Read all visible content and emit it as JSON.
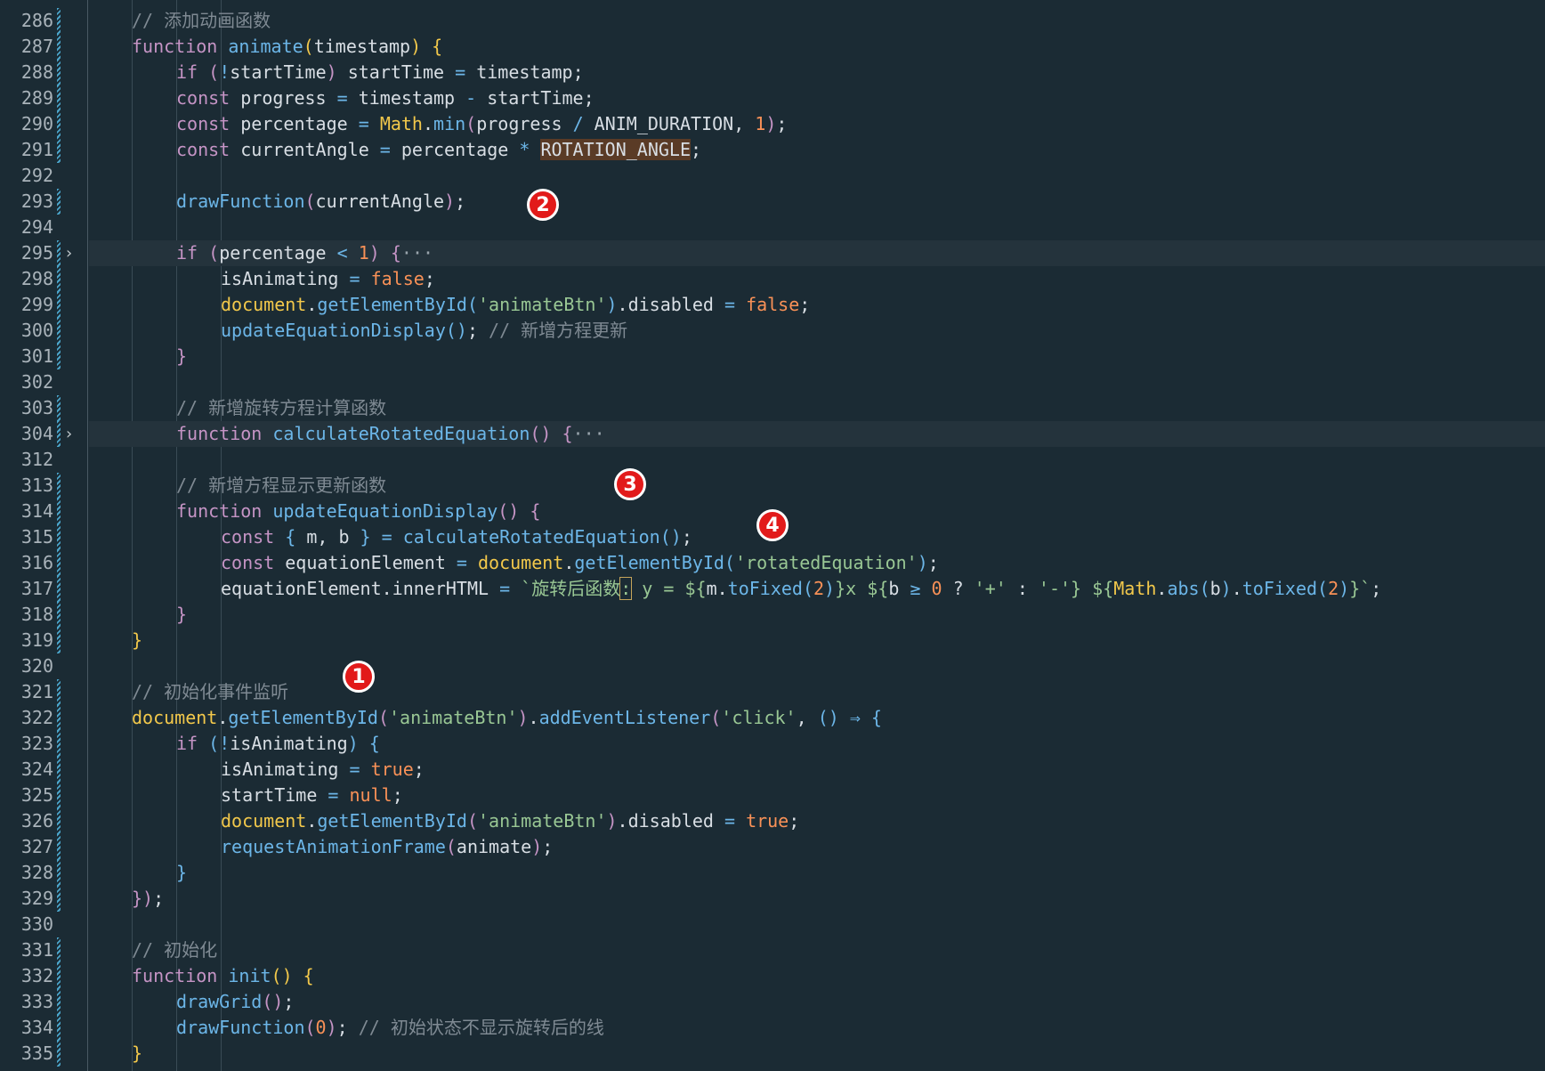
{
  "line_numbers": [
    "286",
    "287",
    "288",
    "289",
    "290",
    "291",
    "292",
    "293",
    "294",
    "295",
    "298",
    "299",
    "300",
    "301",
    "302",
    "303",
    "304",
    "312",
    "313",
    "314",
    "315",
    "316",
    "317",
    "318",
    "319",
    "320",
    "321",
    "322",
    "323",
    "324",
    "325",
    "326",
    "327",
    "328",
    "329",
    "330",
    "331",
    "332",
    "333",
    "334",
    "335"
  ],
  "code": {
    "l286": "// 添加动画函数",
    "l287": [
      "function",
      "animate",
      "(",
      "timestamp",
      ")",
      " {"
    ],
    "l288": [
      "if",
      " (",
      "!",
      "startTime",
      ")",
      " startTime ",
      "=",
      " timestamp",
      ";"
    ],
    "l289": [
      "const",
      " progress ",
      "=",
      " timestamp ",
      "-",
      " startTime",
      ";"
    ],
    "l290": [
      "const",
      " percentage ",
      "=",
      " ",
      "Math",
      ".",
      "min",
      "(",
      "progress ",
      "/",
      " ANIM_DURATION, ",
      "1",
      ")",
      ";"
    ],
    "l291": [
      "const",
      " currentAngle ",
      "=",
      " percentage ",
      "*",
      " ",
      "ROTATION_ANGLE",
      ";"
    ],
    "l293": [
      "drawFunction",
      "(",
      "currentAngle",
      ")",
      ";"
    ],
    "l295": [
      "if",
      " (",
      "percentage ",
      "<",
      " ",
      "1",
      ")",
      " {",
      "···"
    ],
    "l298": [
      "isAnimating ",
      "=",
      " ",
      "false",
      ";"
    ],
    "l299": [
      "document",
      ".",
      "getElementById",
      "(",
      "'animateBtn'",
      ")",
      ".disabled ",
      "=",
      " ",
      "false",
      ";"
    ],
    "l300": [
      "updateEquationDisplay",
      "()",
      ";",
      " // 新增方程更新"
    ],
    "l301": "}",
    "l303": "// 新增旋转方程计算函数",
    "l304": [
      "function",
      " ",
      "calculateRotatedEquation",
      "()",
      " {",
      "···"
    ],
    "l313": "// 新增方程显示更新函数",
    "l314": [
      "function",
      " ",
      "updateEquationDisplay",
      "()",
      " {"
    ],
    "l315": [
      "const",
      " { ",
      "m, b",
      " } ",
      "=",
      " ",
      "calculateRotatedEquation",
      "()",
      ";"
    ],
    "l316": [
      "const",
      " equationElement ",
      "=",
      " ",
      "document",
      ".",
      "getElementById",
      "(",
      "'rotatedEquation'",
      ")",
      ";"
    ],
    "l317": [
      "equationElement",
      ".innerHTML ",
      "=",
      " `旋转后函数",
      ":",
      " y = ${",
      "m",
      ".",
      "toFixed",
      "(",
      "2",
      ")",
      "}x ${",
      "b ",
      "≥",
      " ",
      "0",
      " ? ",
      "'+'",
      " : ",
      "'-'",
      "} ${",
      "Math",
      ".",
      "abs",
      "(",
      "b",
      ")",
      ".",
      "toFixed",
      "(",
      "2",
      ")",
      "}`",
      ";"
    ],
    "l318": "}",
    "l319": "}",
    "l321": "// 初始化事件监听",
    "l322": [
      "document",
      ".",
      "getElementById",
      "(",
      "'animateBtn'",
      ")",
      ".",
      "addEventListener",
      "(",
      "'click'",
      ", ",
      "()",
      " ",
      "⇒",
      " {"
    ],
    "l323": [
      "if",
      " (",
      "!",
      "isAnimating",
      ")",
      " {"
    ],
    "l324": [
      "isAnimating ",
      "=",
      " ",
      "true",
      ";"
    ],
    "l325": [
      "startTime ",
      "=",
      " ",
      "null",
      ";"
    ],
    "l326": [
      "document",
      ".",
      "getElementById",
      "(",
      "'animateBtn'",
      ")",
      ".disabled ",
      "=",
      " ",
      "true",
      ";"
    ],
    "l327": [
      "requestAnimationFrame",
      "(",
      "animate",
      ")",
      ";"
    ],
    "l328": "}",
    "l329": [
      "}",
      ")",
      ";"
    ],
    "l331": "// 初始化",
    "l332": [
      "function",
      " ",
      "init",
      "()",
      " {"
    ],
    "l333": [
      "drawGrid",
      "()",
      ";"
    ],
    "l334": [
      "drawFunction",
      "(",
      "0",
      ")",
      ";",
      " // 初始状态不显示旋转后的线"
    ],
    "l335": "}"
  },
  "badges": [
    "1",
    "2",
    "3",
    "4"
  ],
  "colors": {
    "background": "#1b2b34",
    "keyword": "#c594c5",
    "function": "#6cb6e8",
    "class": "#f2c84b",
    "number": "#f99157",
    "string": "#99c794",
    "comment": "#7f8a93",
    "badge": "#e21a1a"
  }
}
